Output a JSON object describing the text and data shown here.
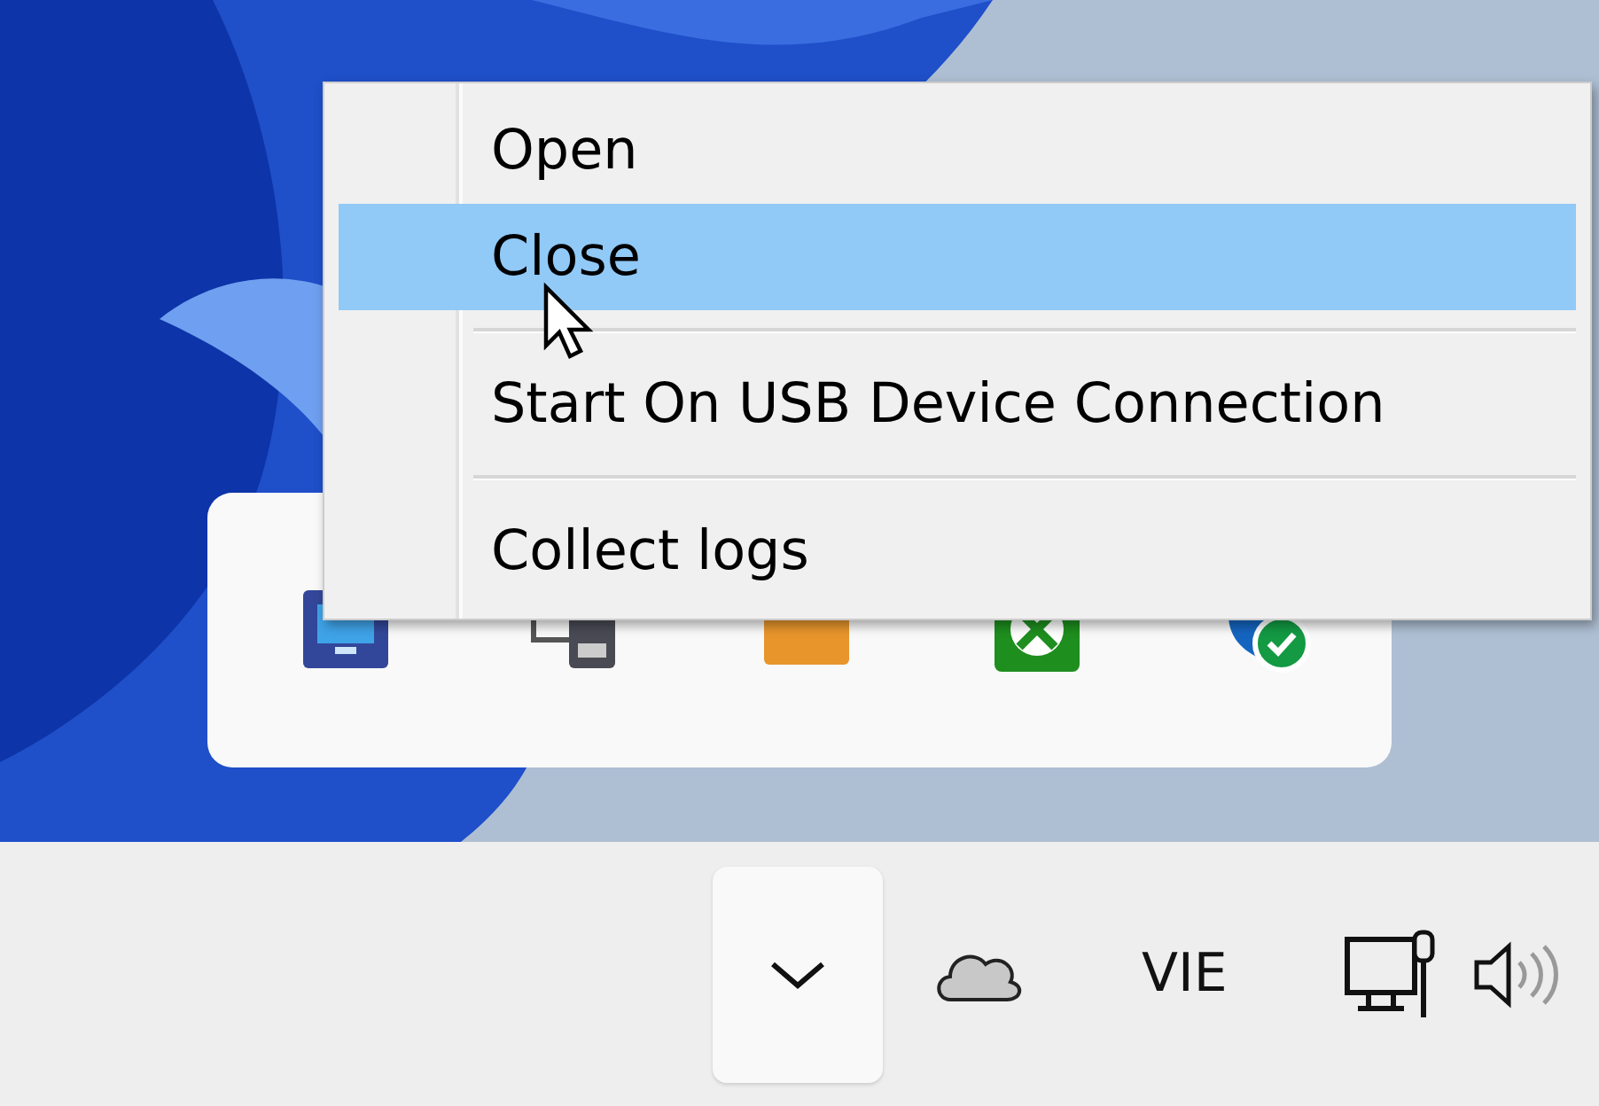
{
  "context_menu": {
    "items": [
      {
        "kind": "item",
        "label": "Open",
        "selected": false
      },
      {
        "kind": "item",
        "label": "Close",
        "selected": true
      },
      {
        "kind": "separator"
      },
      {
        "kind": "item",
        "label": "Start On USB Device Connection",
        "selected": false
      },
      {
        "kind": "separator"
      },
      {
        "kind": "item",
        "label": "Collect logs",
        "selected": false
      }
    ]
  },
  "taskbar": {
    "language": "VIE"
  }
}
